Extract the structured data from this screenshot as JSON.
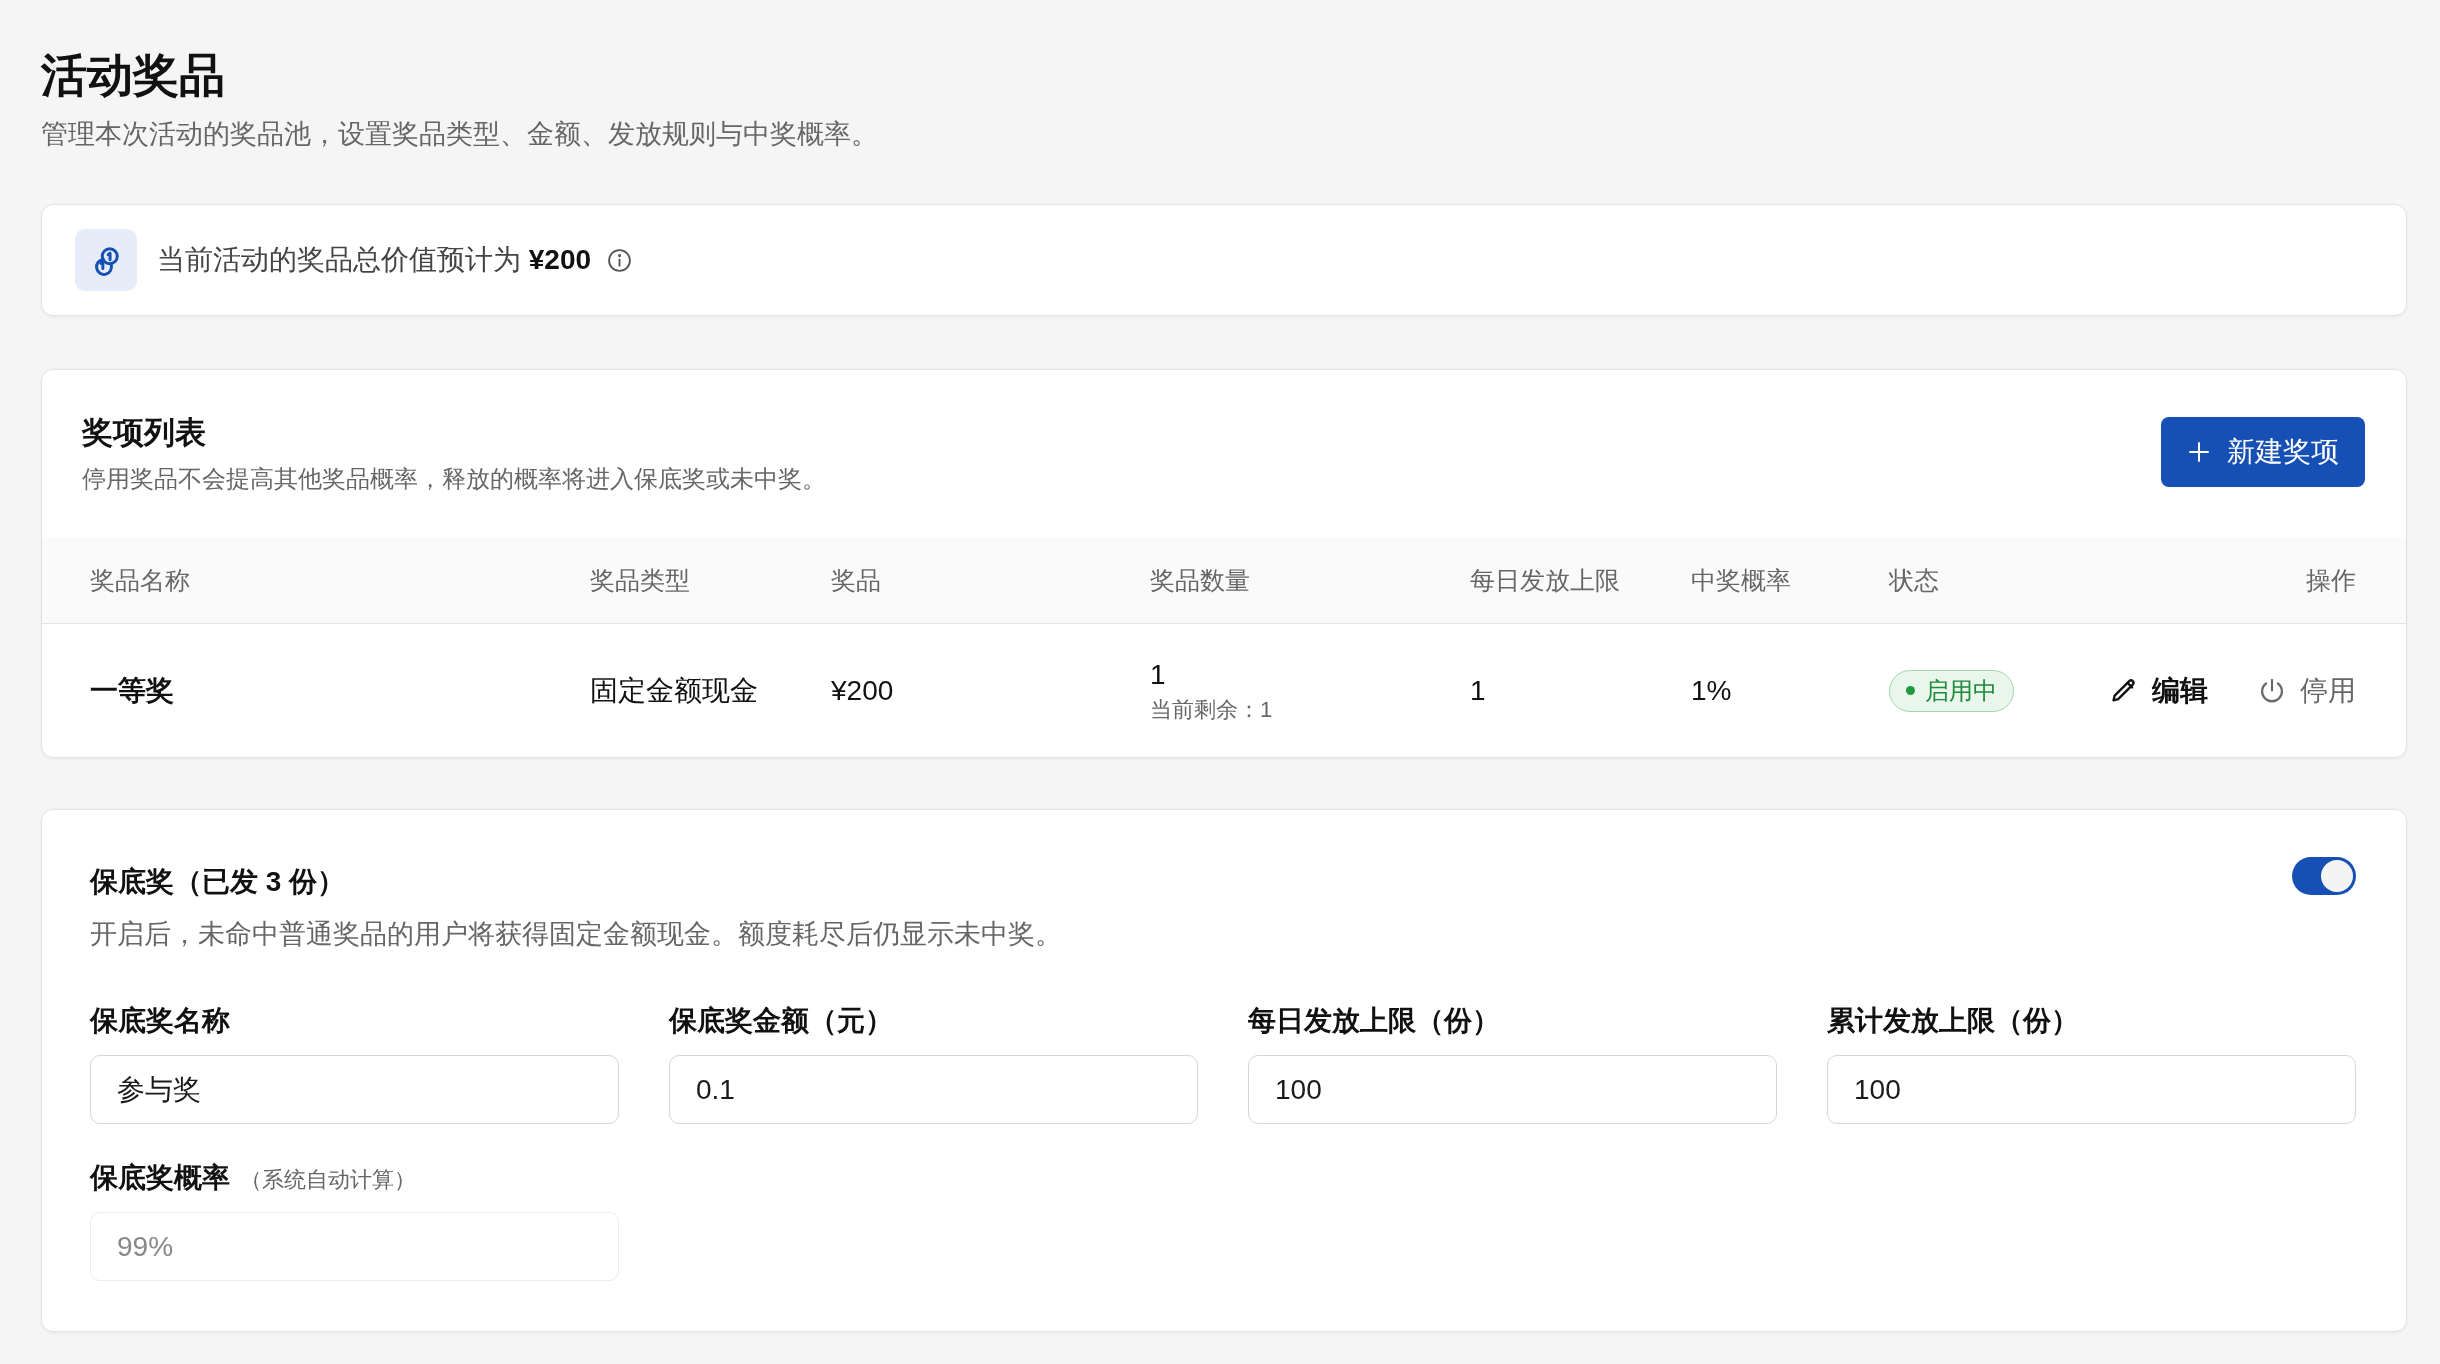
{
  "page": {
    "title": "活动奖品",
    "description": "管理本次活动的奖品池，设置奖品类型、金额、发放规则与中奖概率。"
  },
  "summary": {
    "text": "当前活动的奖品总价值预计为 **¥200**"
  },
  "prize_list": {
    "title": "奖项列表",
    "description": "停用奖品不会提高其他奖品概率，释放的概率将进入保底奖或未中奖。",
    "new_button": {
      "label": "新建奖项"
    },
    "table": {
      "columns": [
        "奖品名称",
        "奖品类型",
        "奖品",
        "奖品数量",
        "每日发放上限",
        "中奖概率",
        "状态",
        "操作"
      ],
      "rows": [
        {
          "name": "一等奖",
          "type": "固定金额现金",
          "prize": "¥200",
          "quantity": "1",
          "remaining": "当前剩余：1",
          "daily_limit": "1",
          "probability": "1%",
          "status": {
            "label": "启用中",
            "active": true
          },
          "actions": [
            {
              "kind": "edit",
              "label": "编辑"
            },
            {
              "kind": "disable",
              "label": "停用"
            }
          ]
        }
      ]
    }
  },
  "guarantee": {
    "title": "保底奖（已发 3 份）",
    "description": "开启后，未命中普通奖品的用户将获得固定金额现金。额度耗尽后仍显示未中奖。",
    "on": true,
    "fields": [
      {
        "label": "保底奖名称",
        "value": "参与奖",
        "disabled": false
      },
      {
        "label": "保底奖金额（元）",
        "value": "0.1",
        "disabled": false
      },
      {
        "label": "每日发放上限（份）",
        "value": "100",
        "disabled": false
      },
      {
        "label": "累计发放上限（份）",
        "value": "100",
        "disabled": false
      },
      {
        "label": "保底奖概率",
        "note": "（系统自动计算）",
        "value": "99%",
        "disabled": true
      }
    ]
  }
}
